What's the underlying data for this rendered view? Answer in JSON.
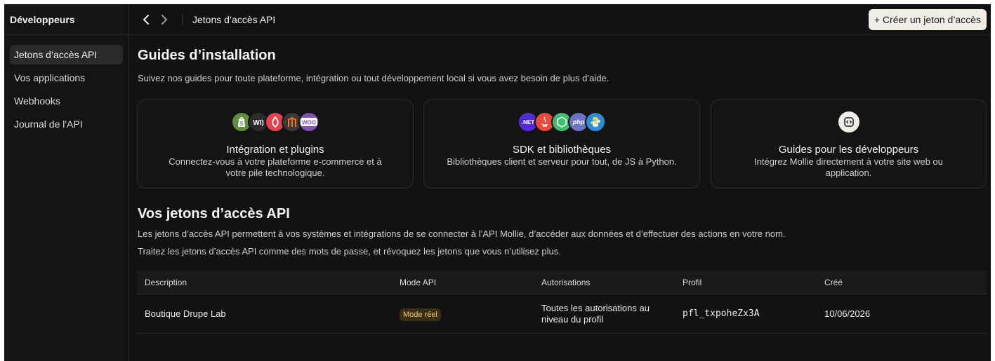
{
  "sidebar": {
    "title": "Développeurs",
    "items": [
      {
        "label": "Jetons d’accès API",
        "active": true
      },
      {
        "label": "Vos applications",
        "active": false
      },
      {
        "label": "Webhooks",
        "active": false
      },
      {
        "label": "Journal de l'API",
        "active": false
      }
    ]
  },
  "topbar": {
    "title": "Jetons d’accès API",
    "create_label": "+ Créer un jeton d’accès"
  },
  "guides": {
    "title": "Guides d’installation",
    "subtitle": "Suivez nos guides pour toute plateforme, intégration ou tout développement local si vous avez besoin de plus d’aide.",
    "cards": [
      {
        "title": "Intégration et plugins",
        "description": "Connectez-vous à votre plateforme e-commerce et à votre pile technologique.",
        "logos": [
          "shopify-icon",
          "wix-icon",
          "lightspeed-icon",
          "magento-icon",
          "woocommerce-icon"
        ]
      },
      {
        "title": "SDK et bibliothèques",
        "description": "Bibliothèques client et serveur pour tout, de JS à Python.",
        "logos": [
          "dotnet-icon",
          "java-icon",
          "nodejs-icon",
          "php-icon",
          "python-icon"
        ]
      },
      {
        "title": "Guides pour les développeurs",
        "description": "Intégrez Mollie directement à votre site web ou application.",
        "logos": [
          "code-icon"
        ]
      }
    ]
  },
  "tokens": {
    "title": "Vos jetons d’accès API",
    "para1": "Les jetons d’accès API permettent à vos systèmes et intégrations de se connecter à l’API Mollie, d’accéder aux données et d’effectuer des actions en votre nom.",
    "para2": "Traitez les jetons d’accès API comme des mots de passe, et révoquez les jetons que vous n’utilisez plus.",
    "columns": [
      "Description",
      "Mode API",
      "Autorisations",
      "Profil",
      "Créé"
    ],
    "rows": [
      {
        "description": "Boutique Drupe Lab",
        "mode": "Mode réel",
        "permissions": "Toutes les autorisations au niveau du profil",
        "profile": "pfl_txpoheZx3A",
        "created": "10/06/2026"
      }
    ]
  },
  "colors": {
    "background": "#121212",
    "accent_button": "#f1ece6",
    "badge_bg": "#3a3018",
    "badge_text": "#f1c96a"
  }
}
